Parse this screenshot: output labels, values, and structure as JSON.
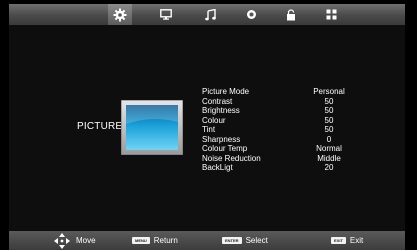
{
  "tabs": [
    {
      "icon": "picture-gear-icon",
      "active": true
    },
    {
      "icon": "monitor-icon",
      "active": false
    },
    {
      "icon": "music-note-icon",
      "active": false
    },
    {
      "icon": "clock-icon",
      "active": false
    },
    {
      "icon": "lock-icon",
      "active": false
    },
    {
      "icon": "grid-icon",
      "active": false
    }
  ],
  "section": {
    "title": "PICTURE",
    "icon": "screen-icon"
  },
  "settings": [
    {
      "label": "Picture Mode",
      "value": "Personal"
    },
    {
      "label": "Contrast",
      "value": "50"
    },
    {
      "label": "Brightness",
      "value": "50"
    },
    {
      "label": "Colour",
      "value": "50"
    },
    {
      "label": "Tint",
      "value": "50"
    },
    {
      "label": "Sharpness",
      "value": "0"
    },
    {
      "label": "Colour Temp",
      "value": "Normal"
    },
    {
      "label": "Noise Reduction",
      "value": "Middle"
    },
    {
      "label": "BackLigt",
      "value": "20"
    }
  ],
  "footer": {
    "move": {
      "icon": "dpad-icon",
      "label": "Move"
    },
    "return": {
      "key": "MENU",
      "label": "Return"
    },
    "select": {
      "key": "ENTER",
      "label": "Select"
    },
    "exit": {
      "key": "EXIT",
      "label": "Exit"
    }
  },
  "colors": {
    "background": "#000000",
    "menu_bar": "#4a4a4a",
    "screen_blue": "#1aa0d8"
  }
}
